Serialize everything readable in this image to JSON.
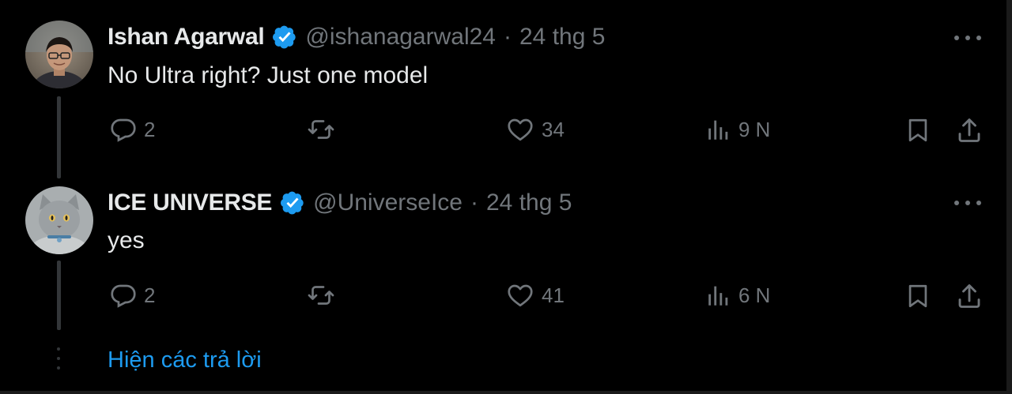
{
  "tweets": [
    {
      "author_name": "Ishan Agarwal",
      "handle": "@ishanagarwal24",
      "separator": "·",
      "date": "24 thg 5",
      "text": "No Ultra right? Just one model",
      "replies": "2",
      "likes": "34",
      "views": "9 N"
    },
    {
      "author_name": "ICE UNIVERSE",
      "handle": "@UniverseIce",
      "separator": "·",
      "date": "24 thg 5",
      "text": "yes",
      "replies": "2",
      "likes": "41",
      "views": "6 N"
    }
  ],
  "show_replies_label": "Hiện các trả lời",
  "colors": {
    "background": "#000000",
    "text_primary": "#e7e9ea",
    "text_secondary": "#71767b",
    "accent": "#1d9bf0",
    "thread_line": "#333639"
  },
  "icons": [
    "verified-badge-icon",
    "more-icon",
    "reply-icon",
    "retweet-icon",
    "like-icon",
    "views-icon",
    "bookmark-icon",
    "share-icon"
  ]
}
